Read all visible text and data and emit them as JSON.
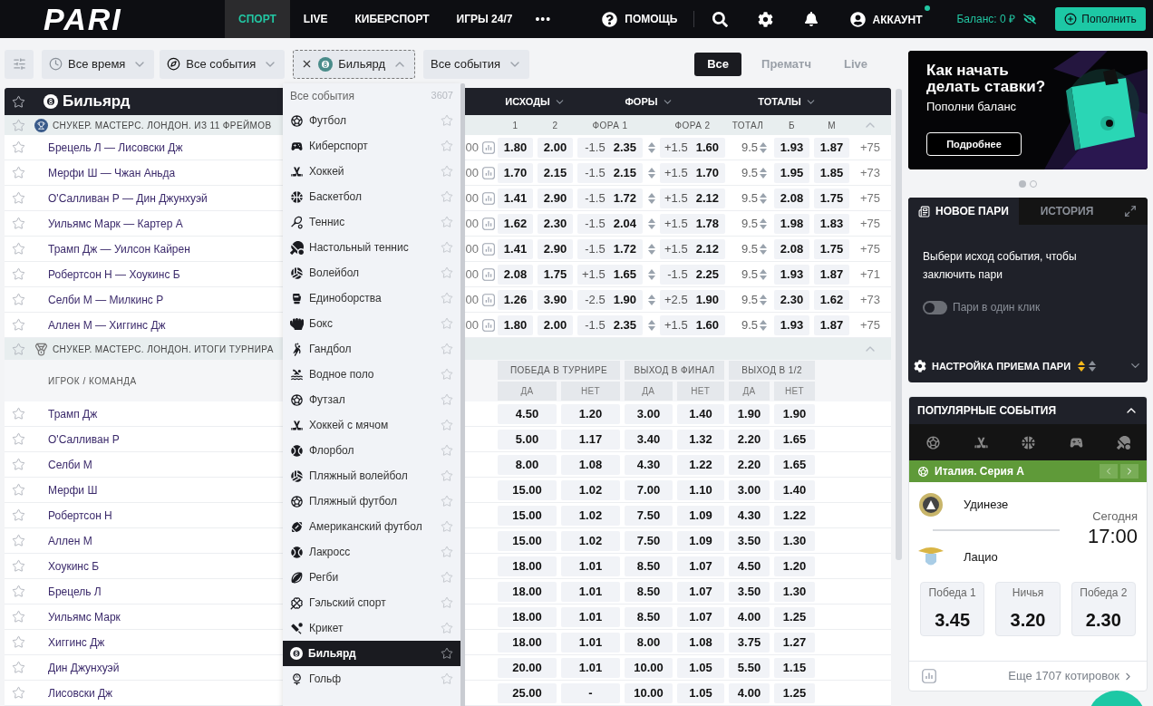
{
  "logo": "PARI",
  "nav": [
    {
      "label": "СПОРТ",
      "selected": true
    },
    {
      "label": "LIVE",
      "selected": false
    },
    {
      "label": "КИБЕРСПОРТ",
      "selected": false
    },
    {
      "label": "ИГРЫ 24/7",
      "selected": false
    }
  ],
  "more_menu": "•••",
  "header_actions": {
    "help": "ПОМОЩЬ",
    "account": "АККАУНТ",
    "account_online": true,
    "balance": "Баланс: 0 ₽",
    "deposit": "Пополнить"
  },
  "filters": [
    {
      "kind": "time",
      "label": "Все время",
      "open": false
    },
    {
      "kind": "events",
      "label": "Все события",
      "open": false
    },
    {
      "kind": "sport",
      "label": "Бильярд",
      "open": true
    },
    {
      "kind": "plain",
      "label": "Все события",
      "open": false
    }
  ],
  "mode_tabs": [
    {
      "label": "Все",
      "selected": true
    },
    {
      "label": "Прематч",
      "selected": false
    },
    {
      "label": "Live",
      "selected": false
    }
  ],
  "sport_title": "Бильярд",
  "market_groups": [
    "ИСХОДЫ",
    "ФОРЫ",
    "ТОТАЛЫ"
  ],
  "match_section": {
    "title": "СНУКЕР. МАСТЕРС. ЛОНДОН. ИЗ 11 ФРЕЙМОВ",
    "expanded": true,
    "columns": [
      "1",
      "2",
      "ФОРА 1",
      "ФОРА 2",
      "ТОТАЛ",
      "Б",
      "М"
    ],
    "rows": [
      {
        "name": "Брецель Л — Лисовски Дж",
        "time_fragment": "00",
        "o1": "1.80",
        "o2": "2.00",
        "h1_line": "-1.5",
        "h1": "2.35",
        "h2_line": "+1.5",
        "h2": "1.60",
        "total": "9.5",
        "over": "1.93",
        "under": "1.87",
        "more": "+75"
      },
      {
        "name": "Мерфи Ш — Чжан Аньда",
        "time_fragment": "00",
        "o1": "1.70",
        "o2": "2.15",
        "h1_line": "-1.5",
        "h1": "2.15",
        "h2_line": "+1.5",
        "h2": "1.70",
        "total": "9.5",
        "over": "1.95",
        "under": "1.85",
        "more": "+73"
      },
      {
        "name": "О'Салливан Р — Дин Джунхуэй",
        "time_fragment": "00",
        "o1": "1.41",
        "o2": "2.90",
        "h1_line": "-1.5",
        "h1": "1.72",
        "h2_line": "+1.5",
        "h2": "2.12",
        "total": "9.5",
        "over": "2.08",
        "under": "1.75",
        "more": "+75"
      },
      {
        "name": "Уильямс Марк — Картер А",
        "time_fragment": "00",
        "o1": "1.62",
        "o2": "2.30",
        "h1_line": "-1.5",
        "h1": "2.04",
        "h2_line": "+1.5",
        "h2": "1.78",
        "total": "9.5",
        "over": "1.98",
        "under": "1.83",
        "more": "+75"
      },
      {
        "name": "Трамп Дж — Уилсон Кайрен",
        "time_fragment": "00",
        "o1": "1.41",
        "o2": "2.90",
        "h1_line": "-1.5",
        "h1": "1.72",
        "h2_line": "+1.5",
        "h2": "2.12",
        "total": "9.5",
        "over": "2.08",
        "under": "1.75",
        "more": "+75"
      },
      {
        "name": "Робертсон Н — Хоукинс Б",
        "time_fragment": "00",
        "o1": "2.08",
        "o2": "1.75",
        "h1_line": "+1.5",
        "h1": "1.65",
        "h2_line": "-1.5",
        "h2": "2.25",
        "total": "9.5",
        "over": "1.93",
        "under": "1.87",
        "more": "+71"
      },
      {
        "name": "Селби М — Милкинс Р",
        "time_fragment": "00",
        "o1": "1.26",
        "o2": "3.90",
        "h1_line": "-2.5",
        "h1": "1.90",
        "h2_line": "+2.5",
        "h2": "1.90",
        "total": "9.5",
        "over": "2.30",
        "under": "1.62",
        "more": "+73"
      },
      {
        "name": "Аллен М — Хиггинс Дж",
        "time_fragment": "00",
        "o1": "1.80",
        "o2": "2.00",
        "h1_line": "-1.5",
        "h1": "2.35",
        "h2_line": "+1.5",
        "h2": "1.60",
        "total": "9.5",
        "over": "1.93",
        "under": "1.87",
        "more": "+75"
      }
    ]
  },
  "outright_section": {
    "title": "СНУКЕР. МАСТЕРС. ЛОНДОН. ИТОГИ ТУРНИРА",
    "expanded": true,
    "head_label": "ИГРОК / КОМАНДА",
    "groups": [
      {
        "title": "ПОБЕДА В ТУРНИРЕ",
        "columns": [
          "ДА",
          "НЕТ"
        ]
      },
      {
        "title": "ВЫХОД В ФИНАЛ",
        "columns": [
          "ДА",
          "НЕТ"
        ]
      },
      {
        "title": "ВЫХОД В 1/2",
        "columns": [
          "ДА",
          "НЕТ"
        ]
      }
    ],
    "rows": [
      {
        "name": "Трамп Дж",
        "odds": [
          "4.50",
          "1.20",
          "3.00",
          "1.40",
          "1.90",
          "1.90"
        ]
      },
      {
        "name": "О'Салливан Р",
        "odds": [
          "5.00",
          "1.17",
          "3.40",
          "1.32",
          "2.20",
          "1.65"
        ]
      },
      {
        "name": "Селби М",
        "odds": [
          "8.00",
          "1.08",
          "4.30",
          "1.22",
          "2.20",
          "1.65"
        ]
      },
      {
        "name": "Мерфи Ш",
        "odds": [
          "15.00",
          "1.02",
          "7.00",
          "1.10",
          "3.00",
          "1.40"
        ]
      },
      {
        "name": "Робертсон Н",
        "odds": [
          "15.00",
          "1.02",
          "7.50",
          "1.09",
          "4.30",
          "1.22"
        ]
      },
      {
        "name": "Аллен М",
        "odds": [
          "15.00",
          "1.02",
          "7.50",
          "1.09",
          "3.50",
          "1.30"
        ]
      },
      {
        "name": "Хоукинс Б",
        "odds": [
          "18.00",
          "1.01",
          "8.50",
          "1.07",
          "4.50",
          "1.20"
        ]
      },
      {
        "name": "Брецель Л",
        "odds": [
          "18.00",
          "1.01",
          "8.50",
          "1.07",
          "3.50",
          "1.30"
        ]
      },
      {
        "name": "Уильямс Марк",
        "odds": [
          "18.00",
          "1.01",
          "8.50",
          "1.07",
          "4.00",
          "1.25"
        ]
      },
      {
        "name": "Хиггинс Дж",
        "odds": [
          "18.00",
          "1.01",
          "8.00",
          "1.08",
          "3.75",
          "1.27"
        ]
      },
      {
        "name": "Дин Джунхуэй",
        "odds": [
          "20.00",
          "1.01",
          "10.00",
          "1.05",
          "5.50",
          "1.15"
        ]
      },
      {
        "name": "Лисовски Дж",
        "odds": [
          "25.00",
          "-",
          "10.00",
          "1.05",
          "4.00",
          "1.25"
        ]
      }
    ]
  },
  "sport_menu": {
    "all_label": "Все события",
    "all_count": "3607",
    "items": [
      {
        "label": "Футбол",
        "selected": false
      },
      {
        "label": "Киберспорт",
        "selected": false
      },
      {
        "label": "Хоккей",
        "selected": false
      },
      {
        "label": "Баскетбол",
        "selected": false
      },
      {
        "label": "Теннис",
        "selected": false
      },
      {
        "label": "Настольный теннис",
        "selected": false
      },
      {
        "label": "Волейбол",
        "selected": false
      },
      {
        "label": "Единоборства",
        "selected": false
      },
      {
        "label": "Бокс",
        "selected": false
      },
      {
        "label": "Гандбол",
        "selected": false
      },
      {
        "label": "Водное поло",
        "selected": false
      },
      {
        "label": "Футзал",
        "selected": false
      },
      {
        "label": "Хоккей с мячом",
        "selected": false
      },
      {
        "label": "Флорбол",
        "selected": false
      },
      {
        "label": "Пляжный волейбол",
        "selected": false
      },
      {
        "label": "Пляжный футбол",
        "selected": false
      },
      {
        "label": "Американский футбол",
        "selected": false
      },
      {
        "label": "Лакросс",
        "selected": false
      },
      {
        "label": "Регби",
        "selected": false
      },
      {
        "label": "Гэльский спорт",
        "selected": false
      },
      {
        "label": "Крикет",
        "selected": false
      },
      {
        "label": "Бильярд",
        "selected": true
      },
      {
        "label": "Гольф",
        "selected": false
      }
    ]
  },
  "promo": {
    "title": "Как начать делать ставки?",
    "subtitle": "Пополни баланс",
    "button": "Подробнее"
  },
  "carousel_dots": [
    {
      "selected": true
    },
    {
      "selected": false
    }
  ],
  "bet_slip": {
    "tabs": [
      {
        "label": "НОВОЕ ПАРИ",
        "selected": true
      },
      {
        "label": "ИСТОРИЯ",
        "selected": false
      }
    ],
    "hint": "Выбери исход события, чтобы заключить пари",
    "one_click": {
      "label": "Пари в один клик",
      "on": false
    },
    "settings_label": "НАСТРОЙКА ПРИЕМА ПАРИ"
  },
  "popular": {
    "title": "ПОПУЛЯРНЫЕ СОБЫТИЯ",
    "expanded": true,
    "league": "Италия. Серия А",
    "match": {
      "home": "Удинезе",
      "away": "Лацио",
      "day": "Сегодня",
      "time": "17:00",
      "odds": [
        {
          "label": "Победа 1",
          "value": "3.45"
        },
        {
          "label": "Ничья",
          "value": "3.20"
        },
        {
          "label": "Победа 2",
          "value": "2.30"
        }
      ]
    },
    "more": "Еще 1707 котировок"
  }
}
